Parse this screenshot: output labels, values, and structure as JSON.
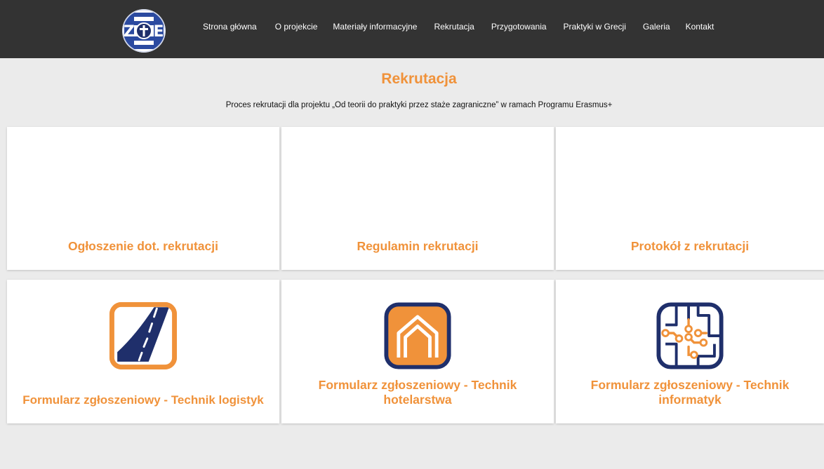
{
  "nav": {
    "items": [
      {
        "label": "Strona główna"
      },
      {
        "label": "O projekcie"
      },
      {
        "label": "Materiały informacyjne"
      },
      {
        "label": "Rekrutacja"
      },
      {
        "label": "Przygotowania"
      },
      {
        "label": "Praktyki w Grecji"
      },
      {
        "label": "Galeria"
      },
      {
        "label": "Kontakt"
      }
    ]
  },
  "main": {
    "title": "Rekrutacja",
    "subtitle": "Proces rekrutacji dla projektu „Od teorii do praktyki przez staże zagraniczne” w ramach Programu Erasmus+"
  },
  "cards": [
    {
      "title": "Ogłoszenie dot. rekrutacji"
    },
    {
      "title": "Regulamin rekrutacji"
    },
    {
      "title": "Protokół z rekrutacji"
    },
    {
      "title": "Formularz zgłoszeniowy - Technik logistyk",
      "icon": "road-icon"
    },
    {
      "title": "Formularz zgłoszeniowy - Technik hotelarstwa",
      "icon": "house-icon"
    },
    {
      "title": "Formularz zgłoszeniowy - Technik informatyk",
      "icon": "circuit-icon"
    }
  ],
  "colors": {
    "accent": "#f0923a",
    "navbar": "#333333",
    "background": "#ebebeb",
    "icon_blue": "#1f2f6b"
  }
}
